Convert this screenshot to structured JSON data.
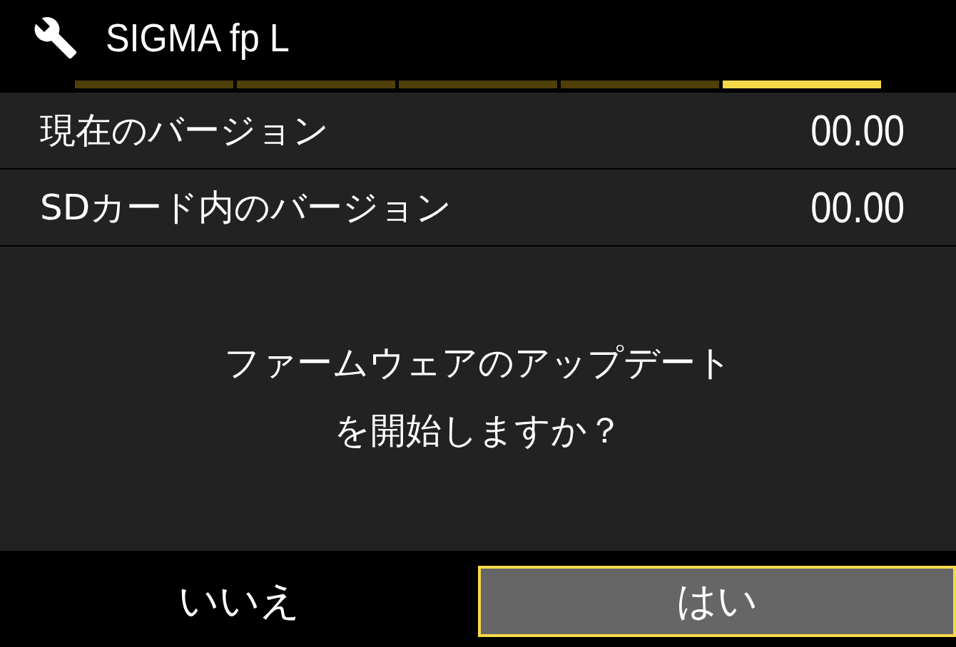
{
  "header": {
    "title": "SIGMA fp L"
  },
  "pages": [
    {
      "selected": false
    },
    {
      "selected": false
    },
    {
      "selected": false
    },
    {
      "selected": false
    },
    {
      "selected": true
    }
  ],
  "rows": [
    {
      "label": "現在のバージョン",
      "value": "00.00"
    },
    {
      "label": "SDカード内のバージョン",
      "value": "00.00"
    }
  ],
  "message": [
    "ファームウェアのアップデート",
    "を開始しますか？"
  ],
  "buttons": [
    {
      "label": "いいえ",
      "selected": false
    },
    {
      "label": "はい",
      "selected": true
    }
  ]
}
